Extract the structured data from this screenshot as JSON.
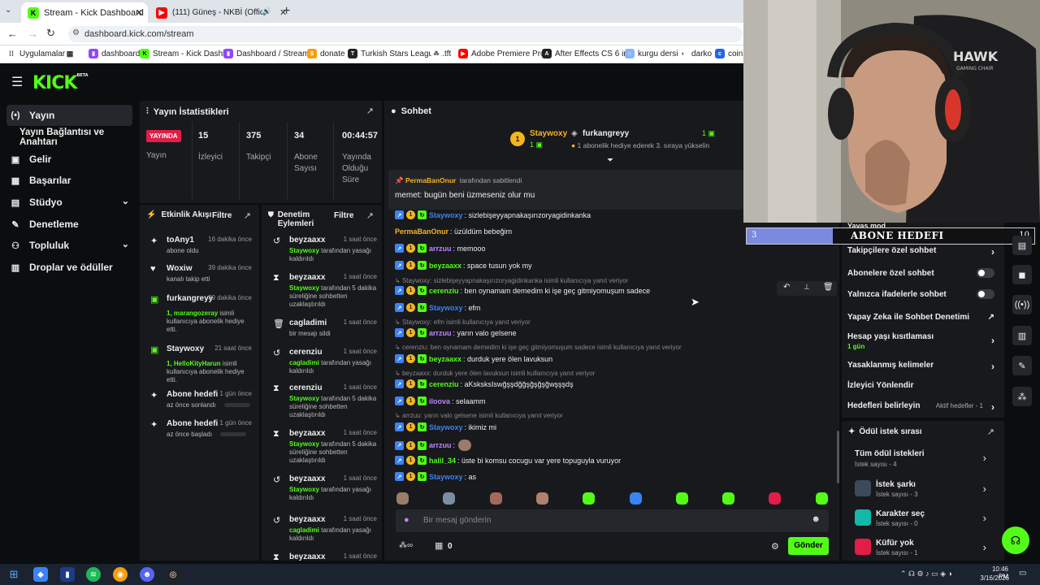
{
  "browser": {
    "tabs": [
      {
        "title": "Stream - Kick Dashboard",
        "active": true
      },
      {
        "title": "(111) Güneş - NKBİ (Officia",
        "active": false
      }
    ],
    "url": "dashboard.kick.com/stream",
    "bookmarks": [
      "Uygulamalar",
      "dashboard",
      "Stream - Kick Dashb...",
      "Dashboard / Stream...",
      "donate",
      "Turkish Stars League...",
      "tft",
      "Adobe Premiere Pro...",
      "After Effects CS 6 in...",
      "kurgu dersi",
      "darko",
      "coinn"
    ]
  },
  "app": {
    "logo": "KICK",
    "logo_beta": "BETA"
  },
  "sidebar": {
    "items": [
      "Yayın",
      "Yayın Bağlantısı ve Anahtarı",
      "Gelir",
      "Başarılar",
      "Stüdyo",
      "Denetleme",
      "Topluluk",
      "Droplar ve ödüller"
    ]
  },
  "stats": {
    "title": "Yayın İstatistikleri",
    "live_badge": "YAYINDA",
    "live_label": "Yayın",
    "items": [
      {
        "value": "15",
        "label": "İzleyici"
      },
      {
        "value": "375",
        "label": "Takipçi"
      },
      {
        "value": "34",
        "label": "Abone Sayısı"
      },
      {
        "value": "00:44:57",
        "label": "Yayında Olduğu Süre"
      }
    ]
  },
  "activity": {
    "title": "Etkinlik Akışı",
    "filter": "Filtre",
    "items": [
      {
        "name": "toAny1",
        "time": "16 dakika önce",
        "text": "abone oldu",
        "icon": "star-icon"
      },
      {
        "name": "Woxiw",
        "time": "39 dakika önce",
        "text": "kanalı takip etti",
        "icon": "heart-icon"
      },
      {
        "name": "furkangreyy",
        "time": "39 dakika önce",
        "hl": "1, marangozeray",
        "text": "isimli kullanıcıya abonelik hediye etti.",
        "icon": "gift-icon"
      },
      {
        "name": "Staywoxy",
        "time": "21 saat önce",
        "hl": "1, HelloKityHarun",
        "text": "isimli kullanıcıya abonelik hediye etti.",
        "icon": "gift-icon"
      },
      {
        "name": "Abone hedefi",
        "time": "1 gün önce",
        "text": "az önce sonlandı",
        "icon": "sparkle-icon"
      },
      {
        "name": "Abone hedefi",
        "time": "1 gün önce",
        "text": "az önce başladı",
        "icon": "sparkle-icon"
      }
    ]
  },
  "moderation": {
    "title": "Denetim Eylemleri",
    "filter": "Filtre",
    "items": [
      {
        "name": "beyzaaxx",
        "time": "1 saat önce",
        "hl": "Staywoxy",
        "text": "tarafından yasağı kaldırıldı",
        "icon": "undo-icon"
      },
      {
        "name": "beyzaaxx",
        "time": "1 saat önce",
        "hl": "Staywoxy",
        "text": "tarafından 5 dakika süreliğine sohbetten uzaklaştırıldı",
        "icon": "hourglass-icon"
      },
      {
        "name": "cagladimi",
        "time": "1 saat önce",
        "hl": "",
        "text": "bir mesajı sildi",
        "icon": "trash-icon"
      },
      {
        "name": "cerenziu",
        "time": "1 saat önce",
        "hl": "cagladimi",
        "text": "tarafından yasağı kaldırıldı",
        "icon": "undo-icon"
      },
      {
        "name": "cerenziu",
        "time": "1 saat önce",
        "hl": "Staywoxy",
        "text": "tarafından 5 dakika süreliğine sohbetten uzaklaştırıldı",
        "icon": "hourglass-icon"
      },
      {
        "name": "beyzaaxx",
        "time": "1 saat önce",
        "hl": "Staywoxy",
        "text": "tarafından 5 dakika süreliğine sohbetten uzaklaştırıldı",
        "icon": "hourglass-icon"
      },
      {
        "name": "beyzaaxx",
        "time": "1 saat önce",
        "hl": "Staywoxy",
        "text": "tarafından yasağı kaldırıldı",
        "icon": "undo-icon"
      },
      {
        "name": "beyzaaxx",
        "time": "1 saat önce",
        "hl": "cagladimi",
        "text": "tarafından yasağı kaldırıldı",
        "icon": "undo-icon"
      },
      {
        "name": "beyzaaxx",
        "time": "1 saat önce",
        "hl": "",
        "text": "",
        "icon": "hourglass-icon"
      }
    ]
  },
  "chat": {
    "title": "Sohbet",
    "gifter1": {
      "rank": "1",
      "name": "Staywoxy",
      "count": "1"
    },
    "gifter2": {
      "name": "furkangreyy",
      "count": "1",
      "note": "1 abonelik hediye ederek 3. sıraya yükselin"
    },
    "pinned_by": "PermaBanOnur",
    "pinned_suffix": "tarafından sabitlendi",
    "pinned_text": "memet: bugün beni üzmeseniz olur mu",
    "messages": [
      {
        "type": "msg",
        "user": "Staywoxy",
        "color": "#3b82f6",
        "text": ": sizlebişeyyapnakaşırızoryagidinkanka"
      },
      {
        "type": "msg",
        "user": "PermaBanOnur",
        "color": "#f5b51f",
        "text": ": üzüldüm bebeğim"
      },
      {
        "type": "msg",
        "user": "arrzuu",
        "color": "#c084fc",
        "text": ": memooo"
      },
      {
        "type": "msg",
        "user": "beyzaaxx",
        "color": "#53fc18",
        "text": ": space tusun yok my"
      },
      {
        "type": "reply",
        "text": "Staywoxy: sizlebişeyyapnakaşırızoryagidinkanka isimli kullanıcıya yanıt veriyor"
      },
      {
        "type": "msg",
        "user": "cerenziu",
        "color": "#53fc18",
        "text": ": ben oynamam demedim ki işe geç gitmiyomuşum sadece"
      },
      {
        "type": "msg",
        "user": "Staywoxy",
        "color": "#3b82f6",
        "text": ": efm"
      },
      {
        "type": "reply",
        "text": "Staywoxy: efm isimli kullanıcıya yanıt veriyor"
      },
      {
        "type": "msg",
        "user": "arrzuu",
        "color": "#c084fc",
        "text": ": yarın valo gelsene"
      },
      {
        "type": "reply",
        "text": "cerenziu: ben oynamam demedim ki işe geç gitmiyomuşum sadece isimli kullanıcıya yanıt veriyor"
      },
      {
        "type": "msg",
        "user": "beyzaaxx",
        "color": "#53fc18",
        "text": ": durduk yere ölen lavuksun"
      },
      {
        "type": "reply",
        "text": "beyzaaxx: durduk yere ölen lavuksun isimli kullanıcıya yanıt veriyor"
      },
      {
        "type": "msg",
        "user": "cerenziu",
        "color": "#53fc18",
        "text": ": aKsksksIswğşşdğğşğşğşğwşşşdş"
      },
      {
        "type": "msg",
        "user": "iloova",
        "color": "#c084fc",
        "text": ": selaamm"
      },
      {
        "type": "reply",
        "text": "arrzuu: yarın valo gelsene isimli kullanıcıya yanıt veriyor"
      },
      {
        "type": "msg",
        "user": "Staywoxy",
        "color": "#3b82f6",
        "text": ": ikimiz mi"
      },
      {
        "type": "msg",
        "user": "arrzuu",
        "color": "#c084fc",
        "text": ":"
      },
      {
        "type": "msg",
        "user": "halil_34",
        "color": "#53fc18",
        "text": ": üste bi komsu cocugu var yere topuguyla vuruyor"
      },
      {
        "type": "msg",
        "user": "Staywoxy",
        "color": "#3b82f6",
        "text": ": as"
      }
    ],
    "input_placeholder": "Bir mesaj gönderin",
    "points": "0",
    "send_label": "Gönder"
  },
  "overlay": {
    "title": "ABONE HEDEFI",
    "current": "3",
    "goal": "10",
    "progress": 0.3
  },
  "settings": {
    "slow_mode": "Yavaş mod",
    "rows": [
      {
        "label": "Takipçilere özel sohbet",
        "kind": "chevron"
      },
      {
        "label": "Abonelere özel sohbet",
        "kind": "toggle"
      },
      {
        "label": "Yalnızca ifadelerle sohbet",
        "kind": "toggle"
      },
      {
        "label": "Yapay Zeka ile Sohbet Denetimi",
        "kind": "external"
      },
      {
        "label": "Hesap yaşı kısıtlaması",
        "sub": "1 gün",
        "kind": "chevron"
      },
      {
        "label": "Yasaklanmış kelimeler",
        "kind": "chevron"
      },
      {
        "label": "İzleyici Yönlendir",
        "kind": "none"
      },
      {
        "label": "Hedefleri belirleyin",
        "extra": "Aktif hedefler - 1",
        "kind": "chevron"
      }
    ]
  },
  "rewards": {
    "title": "Ödül istek sırası",
    "all_label": "Tüm ödül istekleri",
    "all_count": "İstek sayısı - 4",
    "items": [
      {
        "name": "İstek şarkı",
        "count": "İstek sayısı - 3",
        "color": "#3d4a5c"
      },
      {
        "name": "Karakter seç",
        "count": "İstek sayısı - 0",
        "color": "#14b8a6"
      },
      {
        "name": "Küfür yok",
        "count": "İstek sayısı - 1",
        "color": "#e11d48"
      }
    ]
  },
  "taskbar": {
    "time": "10:46 PM",
    "date": "3/16/2026"
  },
  "webcam": {
    "headset_brand": "HAWK",
    "headset_sub": "GAMING CHAIR"
  },
  "colors": {
    "accent": "#53fc18",
    "panel": "#18191d",
    "bg": "#0b0e0f",
    "live": "#e11d48"
  }
}
